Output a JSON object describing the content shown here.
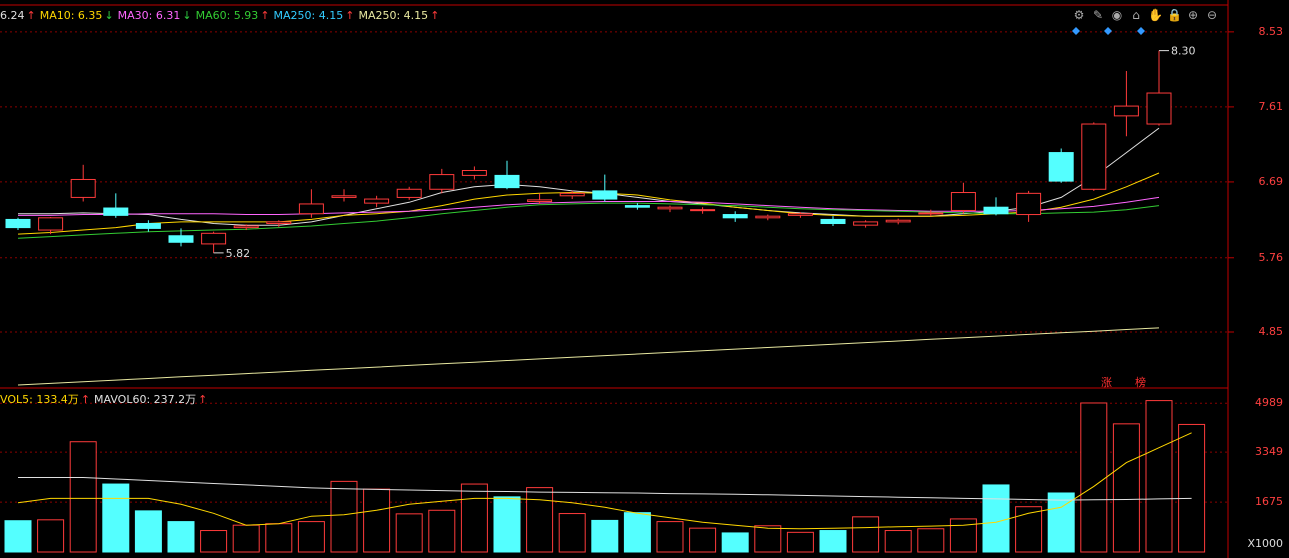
{
  "price_legend": [
    {
      "label": "6.24",
      "dir": "up",
      "color": "#e0e0e0"
    },
    {
      "label": "MA10: 6.35",
      "dir": "down",
      "color": "#ffd700"
    },
    {
      "label": "MA30: 6.31",
      "dir": "down",
      "color": "#ff66ff"
    },
    {
      "label": "MA60: 5.93",
      "dir": "up",
      "color": "#33cc33"
    },
    {
      "label": "MA250: 4.15",
      "dir": "up",
      "color": "#33ccff"
    },
    {
      "label": "MA250: 4.15",
      "dir": "up",
      "color": "#e8e8a0"
    }
  ],
  "vol_legend": [
    {
      "label": "VOL5: 133.4万",
      "dir": "up",
      "color": "#ffd700"
    },
    {
      "label": "MAVOL60: 237.2万",
      "dir": "up",
      "color": "#e0e0e0"
    }
  ],
  "tools": [
    {
      "name": "settings-icon",
      "glyph": "⚙"
    },
    {
      "name": "pen-icon",
      "glyph": "✎"
    },
    {
      "name": "eye-icon",
      "glyph": "◉"
    },
    {
      "name": "basket-icon",
      "glyph": "⌂"
    },
    {
      "name": "hand-icon",
      "glyph": "✋"
    },
    {
      "name": "lock-icon",
      "glyph": "🔒"
    },
    {
      "name": "zoom-in-icon",
      "glyph": "⊕"
    },
    {
      "name": "zoom-out-icon",
      "glyph": "⊖"
    }
  ],
  "price_axis_labels": [
    "8.53",
    "7.61",
    "6.69",
    "5.76",
    "4.85"
  ],
  "vol_axis_labels": [
    "4989",
    "3349",
    "1675"
  ],
  "vol_unit": "X1000",
  "high_label": "8.30",
  "low_label": "5.82",
  "tags": [
    "涨",
    "榜"
  ],
  "colors": {
    "up": "#ff3b3b",
    "down": "#54ffff",
    "grid": "#8b0000",
    "axis": "#c00000"
  },
  "chart_data": [
    {
      "type": "candlestick",
      "ylim": [
        4.2,
        8.7
      ],
      "candles": [
        {
          "o": 6.23,
          "c": 6.13,
          "h": 6.25,
          "l": 6.1
        },
        {
          "o": 6.1,
          "c": 6.25,
          "h": 6.26,
          "l": 6.05
        },
        {
          "o": 6.5,
          "c": 6.72,
          "h": 6.9,
          "l": 6.45
        },
        {
          "o": 6.37,
          "c": 6.28,
          "h": 6.55,
          "l": 6.25
        },
        {
          "o": 6.18,
          "c": 6.12,
          "h": 6.22,
          "l": 6.08
        },
        {
          "o": 6.03,
          "c": 5.95,
          "h": 6.12,
          "l": 5.9
        },
        {
          "o": 5.93,
          "c": 6.06,
          "h": 6.08,
          "l": 5.82
        },
        {
          "o": 6.13,
          "c": 6.15,
          "h": 6.17,
          "l": 6.1
        },
        {
          "o": 6.18,
          "c": 6.2,
          "h": 6.22,
          "l": 6.14
        },
        {
          "o": 6.3,
          "c": 6.42,
          "h": 6.6,
          "l": 6.25
        },
        {
          "o": 6.5,
          "c": 6.52,
          "h": 6.6,
          "l": 6.45
        },
        {
          "o": 6.43,
          "c": 6.48,
          "h": 6.52,
          "l": 6.38
        },
        {
          "o": 6.5,
          "c": 6.6,
          "h": 6.63,
          "l": 6.47
        },
        {
          "o": 6.6,
          "c": 6.78,
          "h": 6.85,
          "l": 6.55
        },
        {
          "o": 6.77,
          "c": 6.83,
          "h": 6.88,
          "l": 6.72
        },
        {
          "o": 6.77,
          "c": 6.62,
          "h": 6.95,
          "l": 6.6
        },
        {
          "o": 6.45,
          "c": 6.47,
          "h": 6.55,
          "l": 6.42
        },
        {
          "o": 6.52,
          "c": 6.55,
          "h": 6.58,
          "l": 6.48
        },
        {
          "o": 6.58,
          "c": 6.48,
          "h": 6.78,
          "l": 6.45
        },
        {
          "o": 6.4,
          "c": 6.38,
          "h": 6.43,
          "l": 6.35
        },
        {
          "o": 6.36,
          "c": 6.38,
          "h": 6.4,
          "l": 6.32
        },
        {
          "o": 6.35,
          "c": 6.35,
          "h": 6.38,
          "l": 6.3
        },
        {
          "o": 6.29,
          "c": 6.25,
          "h": 6.33,
          "l": 6.2
        },
        {
          "o": 6.25,
          "c": 6.27,
          "h": 6.29,
          "l": 6.22
        },
        {
          "o": 6.28,
          "c": 6.3,
          "h": 6.32,
          "l": 6.25
        },
        {
          "o": 6.23,
          "c": 6.18,
          "h": 6.27,
          "l": 6.15
        },
        {
          "o": 6.16,
          "c": 6.2,
          "h": 6.22,
          "l": 6.13
        },
        {
          "o": 6.2,
          "c": 6.22,
          "h": 6.24,
          "l": 6.17
        },
        {
          "o": 6.3,
          "c": 6.31,
          "h": 6.35,
          "l": 6.27
        },
        {
          "o": 6.34,
          "c": 6.56,
          "h": 6.68,
          "l": 6.3
        },
        {
          "o": 6.38,
          "c": 6.3,
          "h": 6.5,
          "l": 6.28
        },
        {
          "o": 6.29,
          "c": 6.55,
          "h": 6.58,
          "l": 6.2
        },
        {
          "o": 7.05,
          "c": 6.7,
          "h": 7.1,
          "l": 6.68
        },
        {
          "o": 6.6,
          "c": 7.4,
          "h": 7.42,
          "l": 6.58
        },
        {
          "o": 7.5,
          "c": 7.62,
          "h": 8.05,
          "l": 7.25
        },
        {
          "o": 7.4,
          "c": 7.78,
          "h": 8.3,
          "l": 7.38
        }
      ],
      "ma_series": [
        {
          "color": "#e0e0e0",
          "values": [
            6.3,
            6.3,
            6.31,
            6.3,
            6.29,
            6.23,
            6.18,
            6.16,
            6.16,
            6.2,
            6.28,
            6.36,
            6.44,
            6.56,
            6.63,
            6.66,
            6.63,
            6.58,
            6.55,
            6.5,
            6.45,
            6.42,
            6.38,
            6.34,
            6.31,
            6.29,
            6.27,
            6.27,
            6.27,
            6.3,
            6.33,
            6.38,
            6.5,
            6.75,
            7.05,
            7.35
          ]
        },
        {
          "color": "#ffd700",
          "values": [
            6.05,
            6.07,
            6.1,
            6.13,
            6.18,
            6.2,
            6.2,
            6.2,
            6.2,
            6.23,
            6.28,
            6.3,
            6.33,
            6.4,
            6.48,
            6.53,
            6.55,
            6.56,
            6.55,
            6.53,
            6.47,
            6.43,
            6.38,
            6.34,
            6.3,
            6.28,
            6.27,
            6.27,
            6.27,
            6.28,
            6.3,
            6.32,
            6.38,
            6.48,
            6.63,
            6.8
          ]
        },
        {
          "color": "#ff66ff",
          "values": [
            6.28,
            6.28,
            6.29,
            6.29,
            6.3,
            6.3,
            6.3,
            6.29,
            6.29,
            6.3,
            6.31,
            6.32,
            6.33,
            6.35,
            6.38,
            6.41,
            6.43,
            6.44,
            6.45,
            6.45,
            6.45,
            6.44,
            6.42,
            6.4,
            6.38,
            6.36,
            6.35,
            6.34,
            6.33,
            6.33,
            6.33,
            6.34,
            6.36,
            6.39,
            6.44,
            6.5
          ]
        },
        {
          "color": "#33cc33",
          "values": [
            6.0,
            6.02,
            6.04,
            6.06,
            6.08,
            6.09,
            6.1,
            6.11,
            6.13,
            6.15,
            6.18,
            6.21,
            6.25,
            6.3,
            6.34,
            6.38,
            6.41,
            6.42,
            6.43,
            6.43,
            6.42,
            6.41,
            6.4,
            6.38,
            6.36,
            6.35,
            6.34,
            6.33,
            6.32,
            6.31,
            6.3,
            6.3,
            6.31,
            6.32,
            6.35,
            6.4
          ]
        },
        {
          "color": "#e8e8a0",
          "values": [
            4.2,
            4.22,
            4.24,
            4.26,
            4.28,
            4.3,
            4.32,
            4.34,
            4.36,
            4.38,
            4.4,
            4.42,
            4.44,
            4.46,
            4.48,
            4.5,
            4.52,
            4.54,
            4.56,
            4.58,
            4.6,
            4.62,
            4.64,
            4.66,
            4.68,
            4.7,
            4.72,
            4.74,
            4.76,
            4.78,
            4.8,
            4.82,
            4.84,
            4.86,
            4.88,
            4.9
          ]
        }
      ]
    },
    {
      "type": "bar",
      "ylim": [
        0,
        5100
      ],
      "unit": "X1000",
      "volumes": [
        1050,
        1080,
        3700,
        2280,
        1380,
        1020,
        720,
        900,
        950,
        1020,
        2370,
        2110,
        1280,
        1400,
        2280,
        1850,
        2160,
        1290,
        1060,
        1320,
        1020,
        800,
        640,
        880,
        660,
        720,
        1180,
        720,
        780,
        1110,
        2250,
        1520,
        1980,
        5000,
        4300,
        5080,
        4280
      ],
      "vol5": [
        1650,
        1800,
        1800,
        1800,
        1800,
        1600,
        1300,
        900,
        950,
        1200,
        1250,
        1400,
        1600,
        1700,
        1800,
        1800,
        1750,
        1650,
        1500,
        1300,
        1150,
        1000,
        900,
        800,
        780,
        800,
        820,
        850,
        870,
        900,
        1000,
        1300,
        1500,
        2200,
        3000,
        3500,
        4000
      ],
      "mavol60": [
        2500,
        2500,
        2500,
        2450,
        2400,
        2350,
        2300,
        2250,
        2200,
        2150,
        2120,
        2100,
        2080,
        2060,
        2040,
        2030,
        2010,
        2000,
        1990,
        1980,
        1960,
        1950,
        1940,
        1920,
        1900,
        1880,
        1860,
        1840,
        1820,
        1800,
        1780,
        1760,
        1740,
        1750,
        1760,
        1780,
        1800
      ]
    }
  ]
}
